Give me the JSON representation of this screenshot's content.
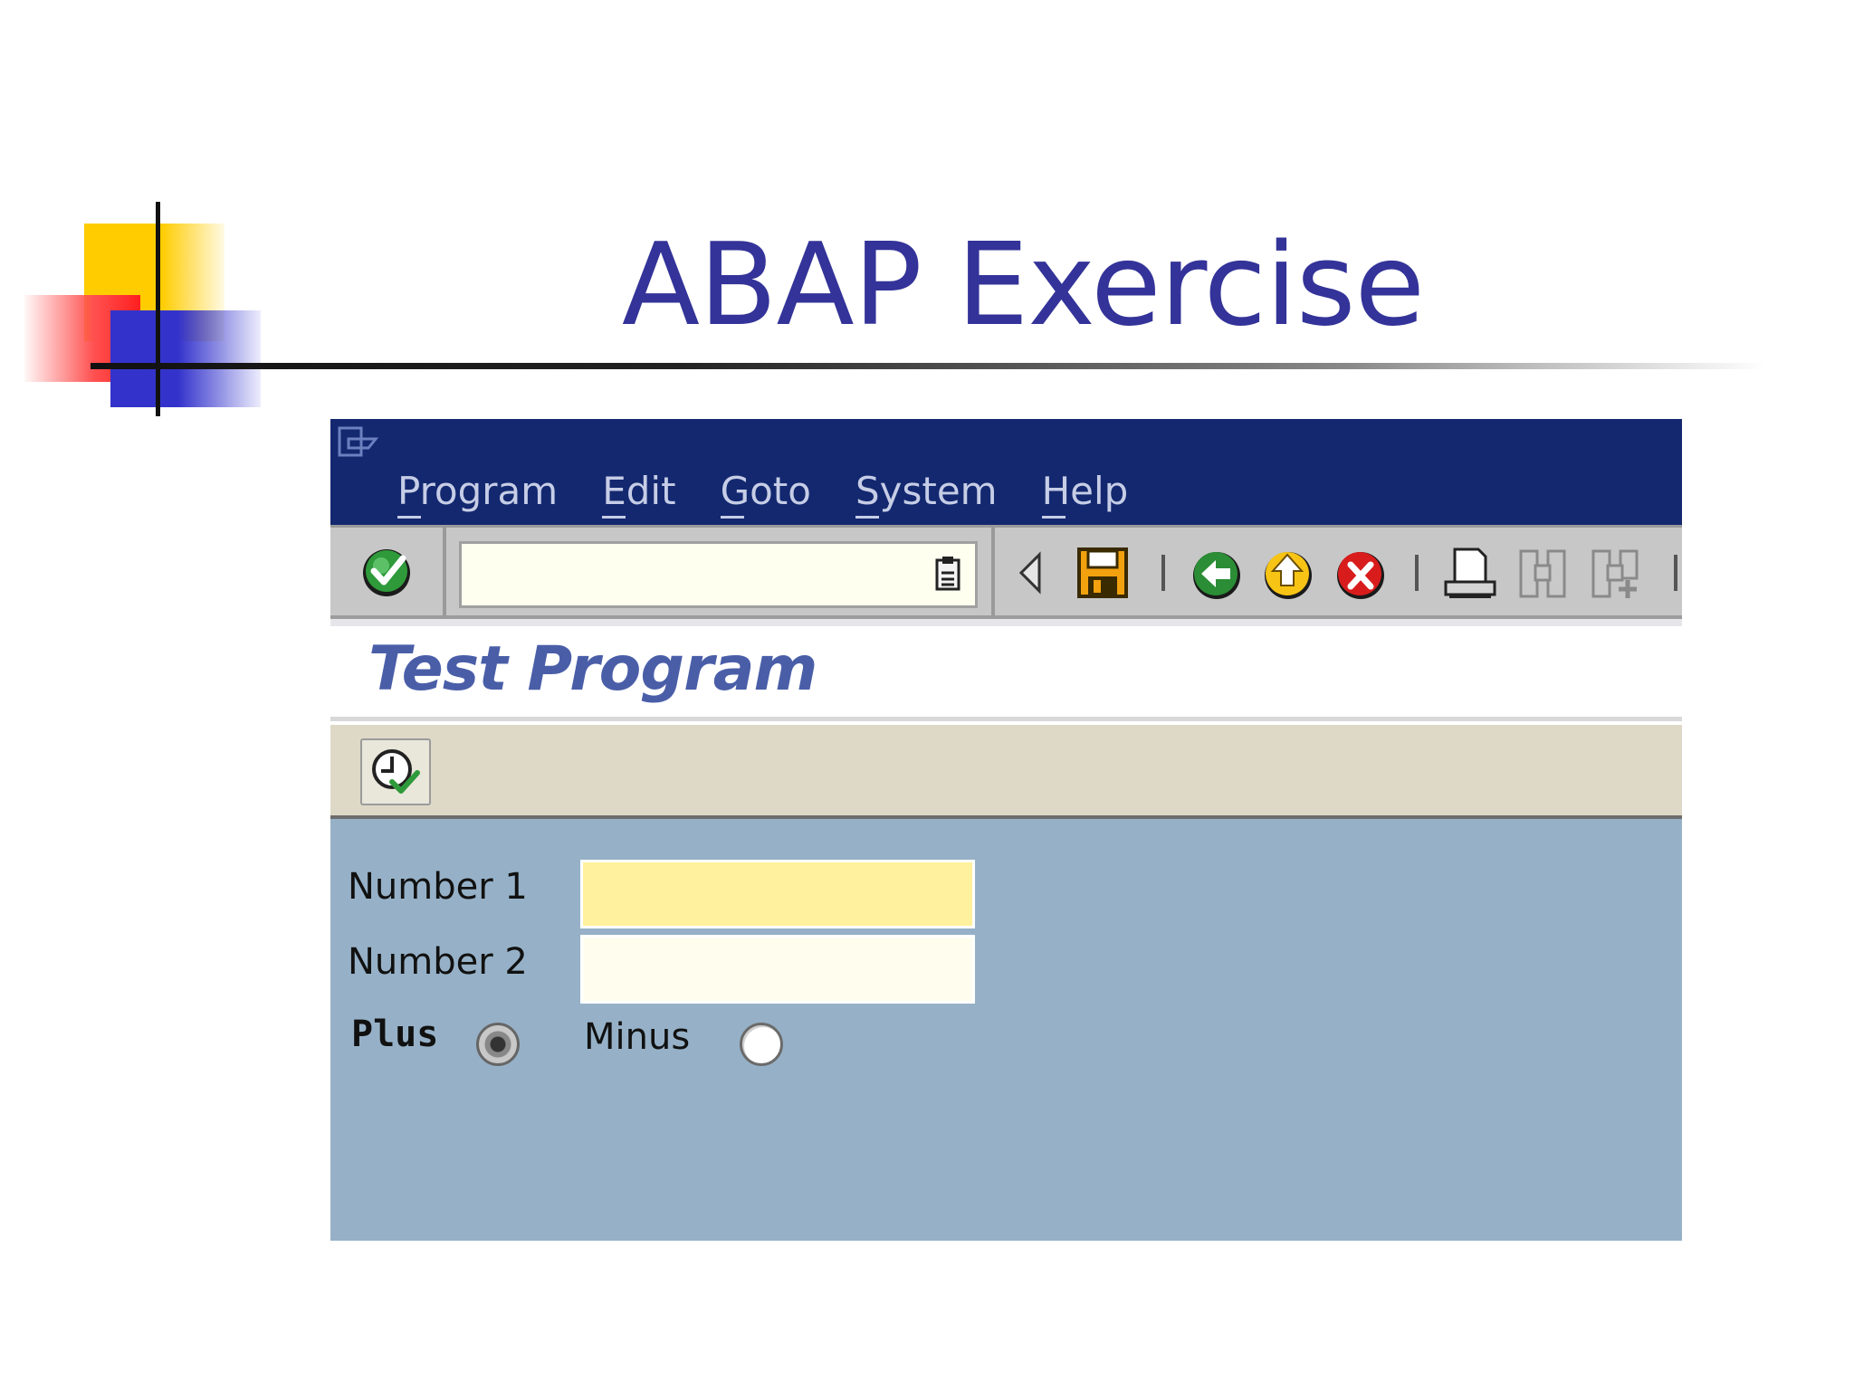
{
  "slide": {
    "title": "ABAP Exercise"
  },
  "sap": {
    "menu": [
      "Program",
      "Edit",
      "Goto",
      "System",
      "Help"
    ],
    "command_field_value": "",
    "program_title": "Test Program",
    "fields": {
      "number1_label": "Number 1",
      "number1_value": "",
      "number2_label": "Number 2",
      "number2_value": ""
    },
    "radios": {
      "plus_label": "Plus",
      "plus_selected": true,
      "minus_label": "Minus",
      "minus_selected": false
    }
  },
  "colors": {
    "title_blue": "#333399",
    "titlebar": "#13286f",
    "screen_bg": "#96b1c7",
    "required_field": "#fff19d"
  },
  "icons": {
    "toolbar": [
      "enter-icon",
      "command-history-icon",
      "back-triangle-icon",
      "save-icon",
      "back-icon",
      "exit-icon",
      "cancel-icon",
      "print-icon",
      "find-icon",
      "find-next-icon"
    ],
    "app_toolbar": [
      "execute-icon"
    ]
  }
}
